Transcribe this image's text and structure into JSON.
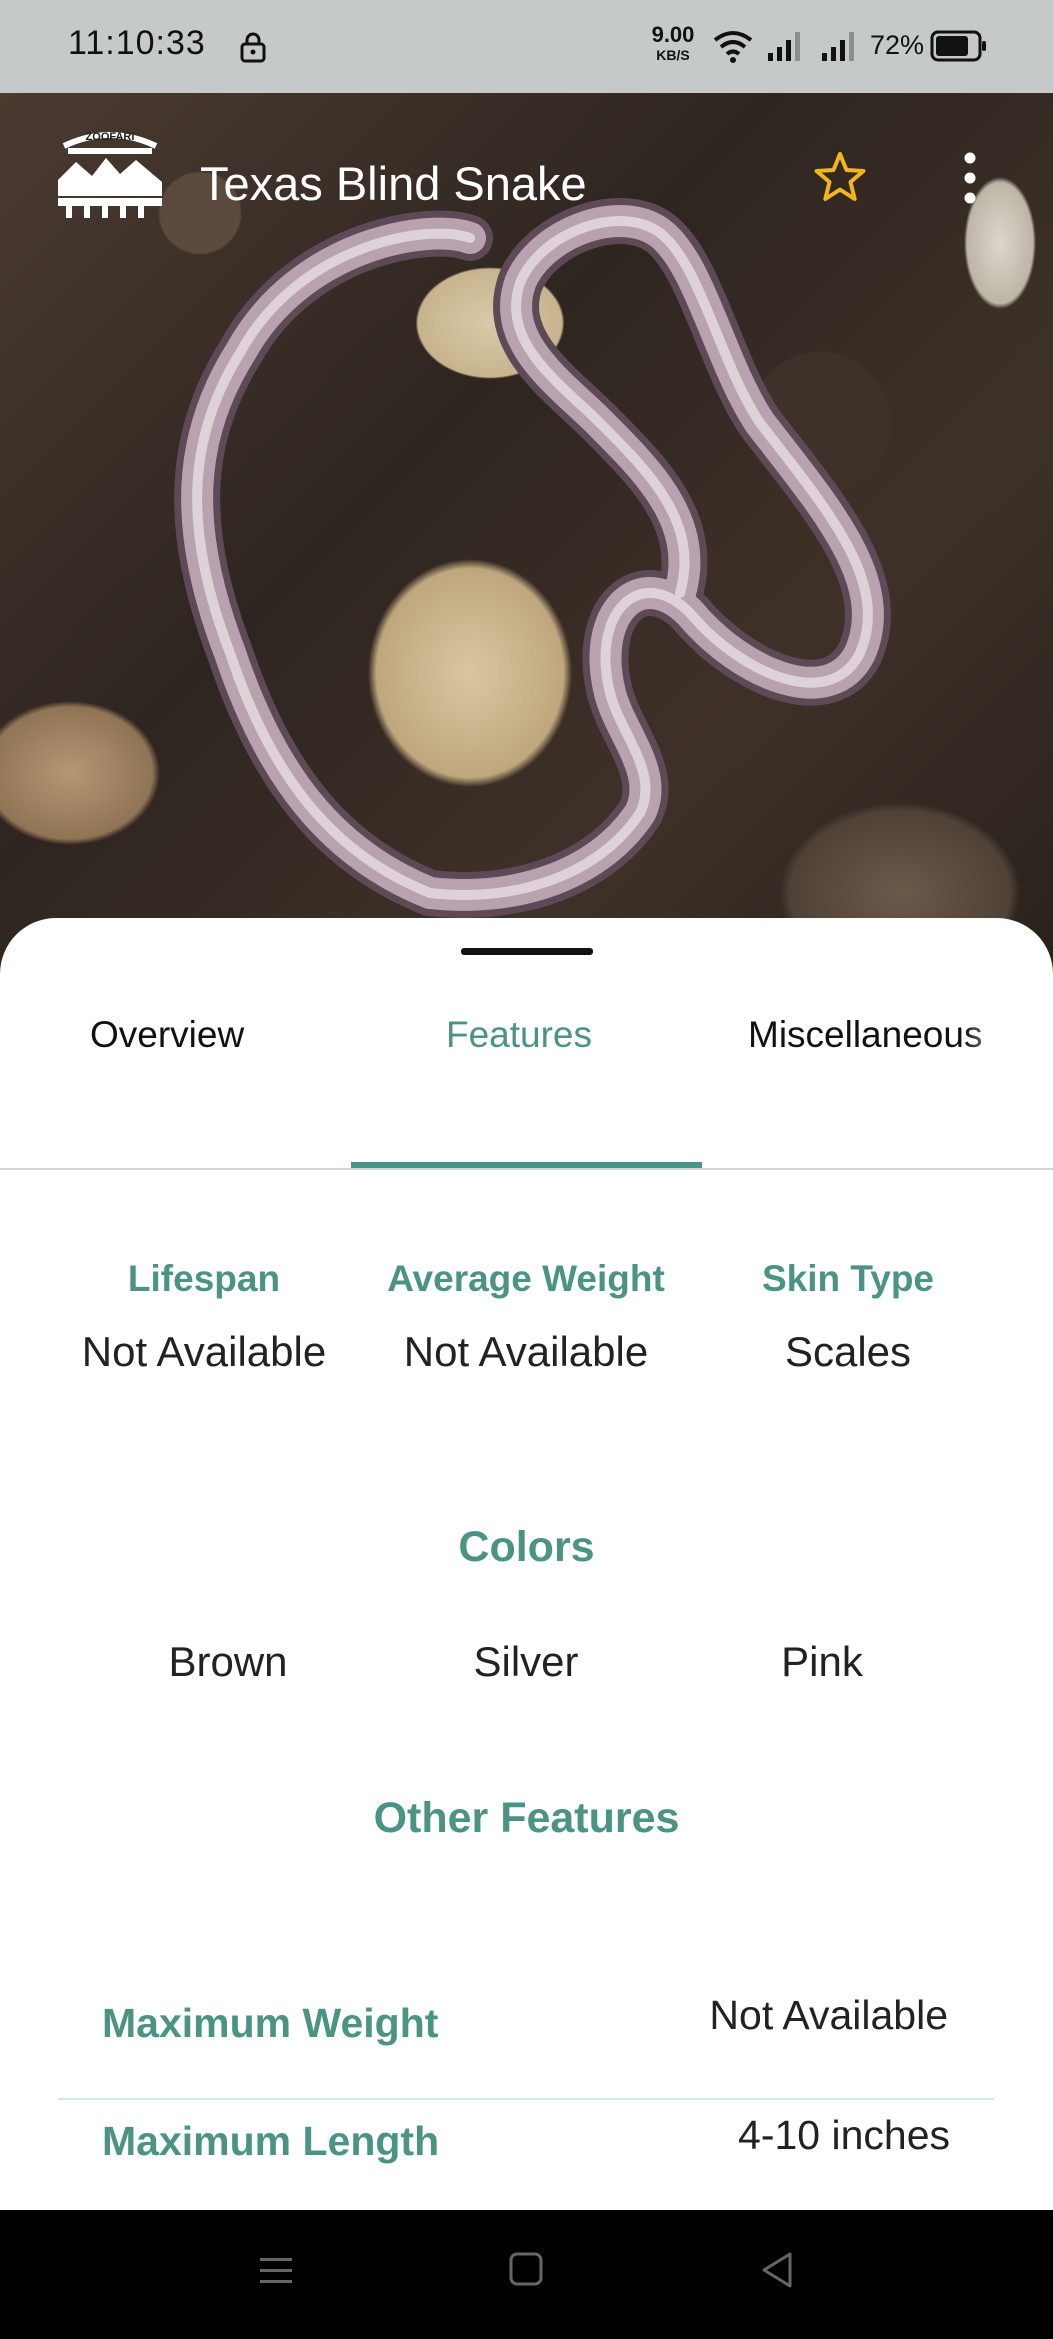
{
  "status_bar": {
    "time": "11:10:33",
    "network_speed_value": "9.00",
    "network_speed_unit": "KB/S",
    "battery_percent": "72%"
  },
  "header": {
    "logo_text": "ZOOFARI",
    "title": "Texas Blind Snake"
  },
  "tabs": [
    {
      "label": "Overview"
    },
    {
      "label": "Features"
    },
    {
      "label": "Miscellaneous"
    }
  ],
  "stats": [
    {
      "label": "Lifespan",
      "value": "Not Available"
    },
    {
      "label": "Average Weight",
      "value": "Not Available"
    },
    {
      "label": "Skin Type",
      "value": "Scales"
    }
  ],
  "colors": {
    "title": "Colors",
    "items": [
      "Brown",
      "Silver",
      "Pink"
    ]
  },
  "other_features": {
    "title": "Other Features",
    "rows": [
      {
        "label": "Maximum Weight",
        "value": "Not Available"
      },
      {
        "label": "Maximum Length",
        "value": "4-10 inches"
      }
    ]
  },
  "theme": {
    "accent": "#4b9484",
    "star": "#f2b51e"
  }
}
